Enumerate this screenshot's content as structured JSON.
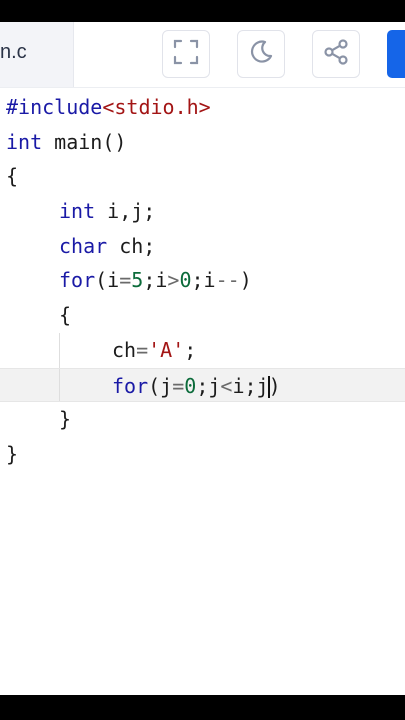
{
  "editor": {
    "file_tab_label": "n.c",
    "toolbar": {
      "fullscreen_icon": "fullscreen-icon",
      "theme_icon": "moon-icon",
      "share_icon": "share-icon",
      "accent_color": "#1565e8"
    },
    "code_lines": [
      {
        "indent": 0,
        "tokens": [
          {
            "t": "kw",
            "v": "#include"
          },
          {
            "t": "str",
            "v": "<stdio.h>"
          }
        ]
      },
      {
        "indent": 0,
        "tokens": [
          {
            "t": "kw",
            "v": "int"
          },
          {
            "t": "plain",
            "v": " main()"
          }
        ]
      },
      {
        "indent": 0,
        "tokens": [
          {
            "t": "plain",
            "v": "{"
          }
        ]
      },
      {
        "indent": 1,
        "tokens": [
          {
            "t": "kw",
            "v": "int"
          },
          {
            "t": "plain",
            "v": " i,j;"
          }
        ]
      },
      {
        "indent": 1,
        "tokens": [
          {
            "t": "kw",
            "v": "char"
          },
          {
            "t": "plain",
            "v": " ch;"
          }
        ]
      },
      {
        "indent": 1,
        "tokens": [
          {
            "t": "kw",
            "v": "for"
          },
          {
            "t": "plain",
            "v": "(i"
          },
          {
            "t": "op",
            "v": "="
          },
          {
            "t": "num",
            "v": "5"
          },
          {
            "t": "plain",
            "v": ";i"
          },
          {
            "t": "op",
            "v": ">"
          },
          {
            "t": "num",
            "v": "0"
          },
          {
            "t": "plain",
            "v": ";i"
          },
          {
            "t": "op",
            "v": "--"
          },
          {
            "t": "plain",
            "v": ")"
          }
        ]
      },
      {
        "indent": 1,
        "tokens": [
          {
            "t": "plain",
            "v": "{"
          }
        ]
      },
      {
        "indent": 2,
        "tokens": [
          {
            "t": "plain",
            "v": "ch"
          },
          {
            "t": "op",
            "v": "="
          },
          {
            "t": "str",
            "v": "'A'"
          },
          {
            "t": "plain",
            "v": ";"
          }
        ]
      },
      {
        "indent": 2,
        "active": true,
        "tokens": [
          {
            "t": "kw",
            "v": "for"
          },
          {
            "t": "plain",
            "v": "(j"
          },
          {
            "t": "op",
            "v": "="
          },
          {
            "t": "num",
            "v": "0"
          },
          {
            "t": "plain",
            "v": ";j"
          },
          {
            "t": "op",
            "v": "<"
          },
          {
            "t": "plain",
            "v": "i;j"
          },
          {
            "t": "caret",
            "v": ""
          },
          {
            "t": "plain",
            "v": ")"
          }
        ]
      },
      {
        "indent": 1,
        "tokens": [
          {
            "t": "plain",
            "v": "}"
          }
        ]
      },
      {
        "indent": 0,
        "tokens": [
          {
            "t": "plain",
            "v": "}"
          }
        ]
      }
    ]
  }
}
